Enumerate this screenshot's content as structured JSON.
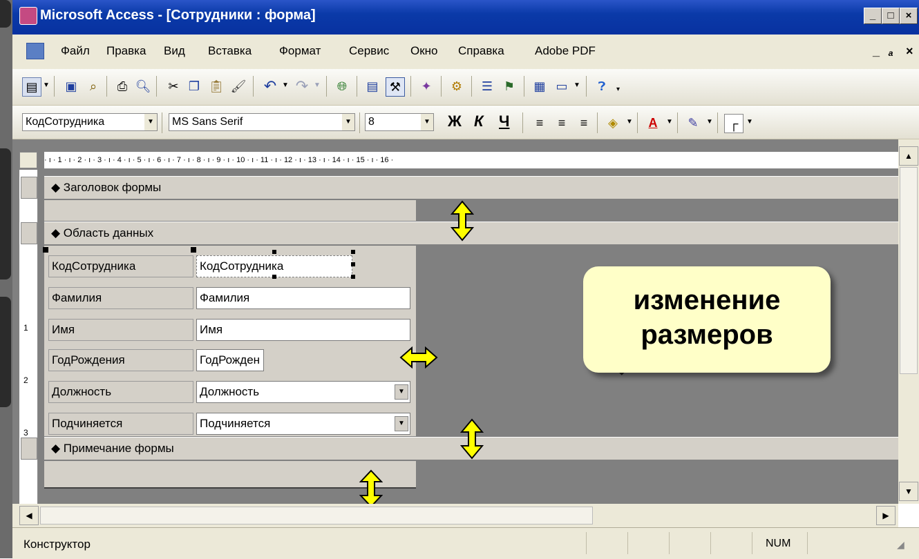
{
  "window": {
    "title": "Microsoft Access - [Сотрудники : форма]"
  },
  "menu": {
    "items": [
      "Файл",
      "Правка",
      "Вид",
      "Вставка",
      "Формат",
      "Сервис",
      "Окно",
      "Справка",
      "Adobe PDF"
    ]
  },
  "toolbar_format": {
    "object_combo": "КодСотрудника",
    "font_combo": "MS Sans Serif",
    "size_combo": "8",
    "bold": "Ж",
    "italic": "К",
    "underline": "Ч"
  },
  "ruler": {
    "marks": "· ı · 1 · ı · 2 · ı · 3 · ı · 4 · ı · 5 · ı · 6 · ı · 7 · ı · 8 · ı · 9 · ı · 10 · ı · 11 · ı · 12 · ı · 13 · ı · 14 · ı · 15 · ı · 16 ·",
    "left_marks": [
      "1",
      "2",
      "3"
    ]
  },
  "sections": {
    "header": "Заголовок формы",
    "detail": "Область данных",
    "footer": "Примечание формы"
  },
  "fields": [
    {
      "label": "КодСотрудника",
      "control": "КодСотрудника",
      "combo": false
    },
    {
      "label": "Фамилия",
      "control": "Фамилия",
      "combo": false
    },
    {
      "label": "Имя",
      "control": "Имя",
      "combo": false
    },
    {
      "label": "ГодРождения",
      "control": "ГодРожден",
      "combo": false
    },
    {
      "label": "Должность",
      "control": "Должность",
      "combo": true
    },
    {
      "label": "Подчиняется",
      "control": "Подчиняется",
      "combo": true
    }
  ],
  "callout": {
    "line1": "изменение",
    "line2": "размеров"
  },
  "status": {
    "mode": "Конструктор",
    "num": "NUM"
  },
  "colors": {
    "titlebar": "#0a3aa8",
    "design_background": "#808080",
    "section": "#d4d0c8",
    "arrow_fill": "#ffff00",
    "callout_fill": "#ffffc8"
  }
}
